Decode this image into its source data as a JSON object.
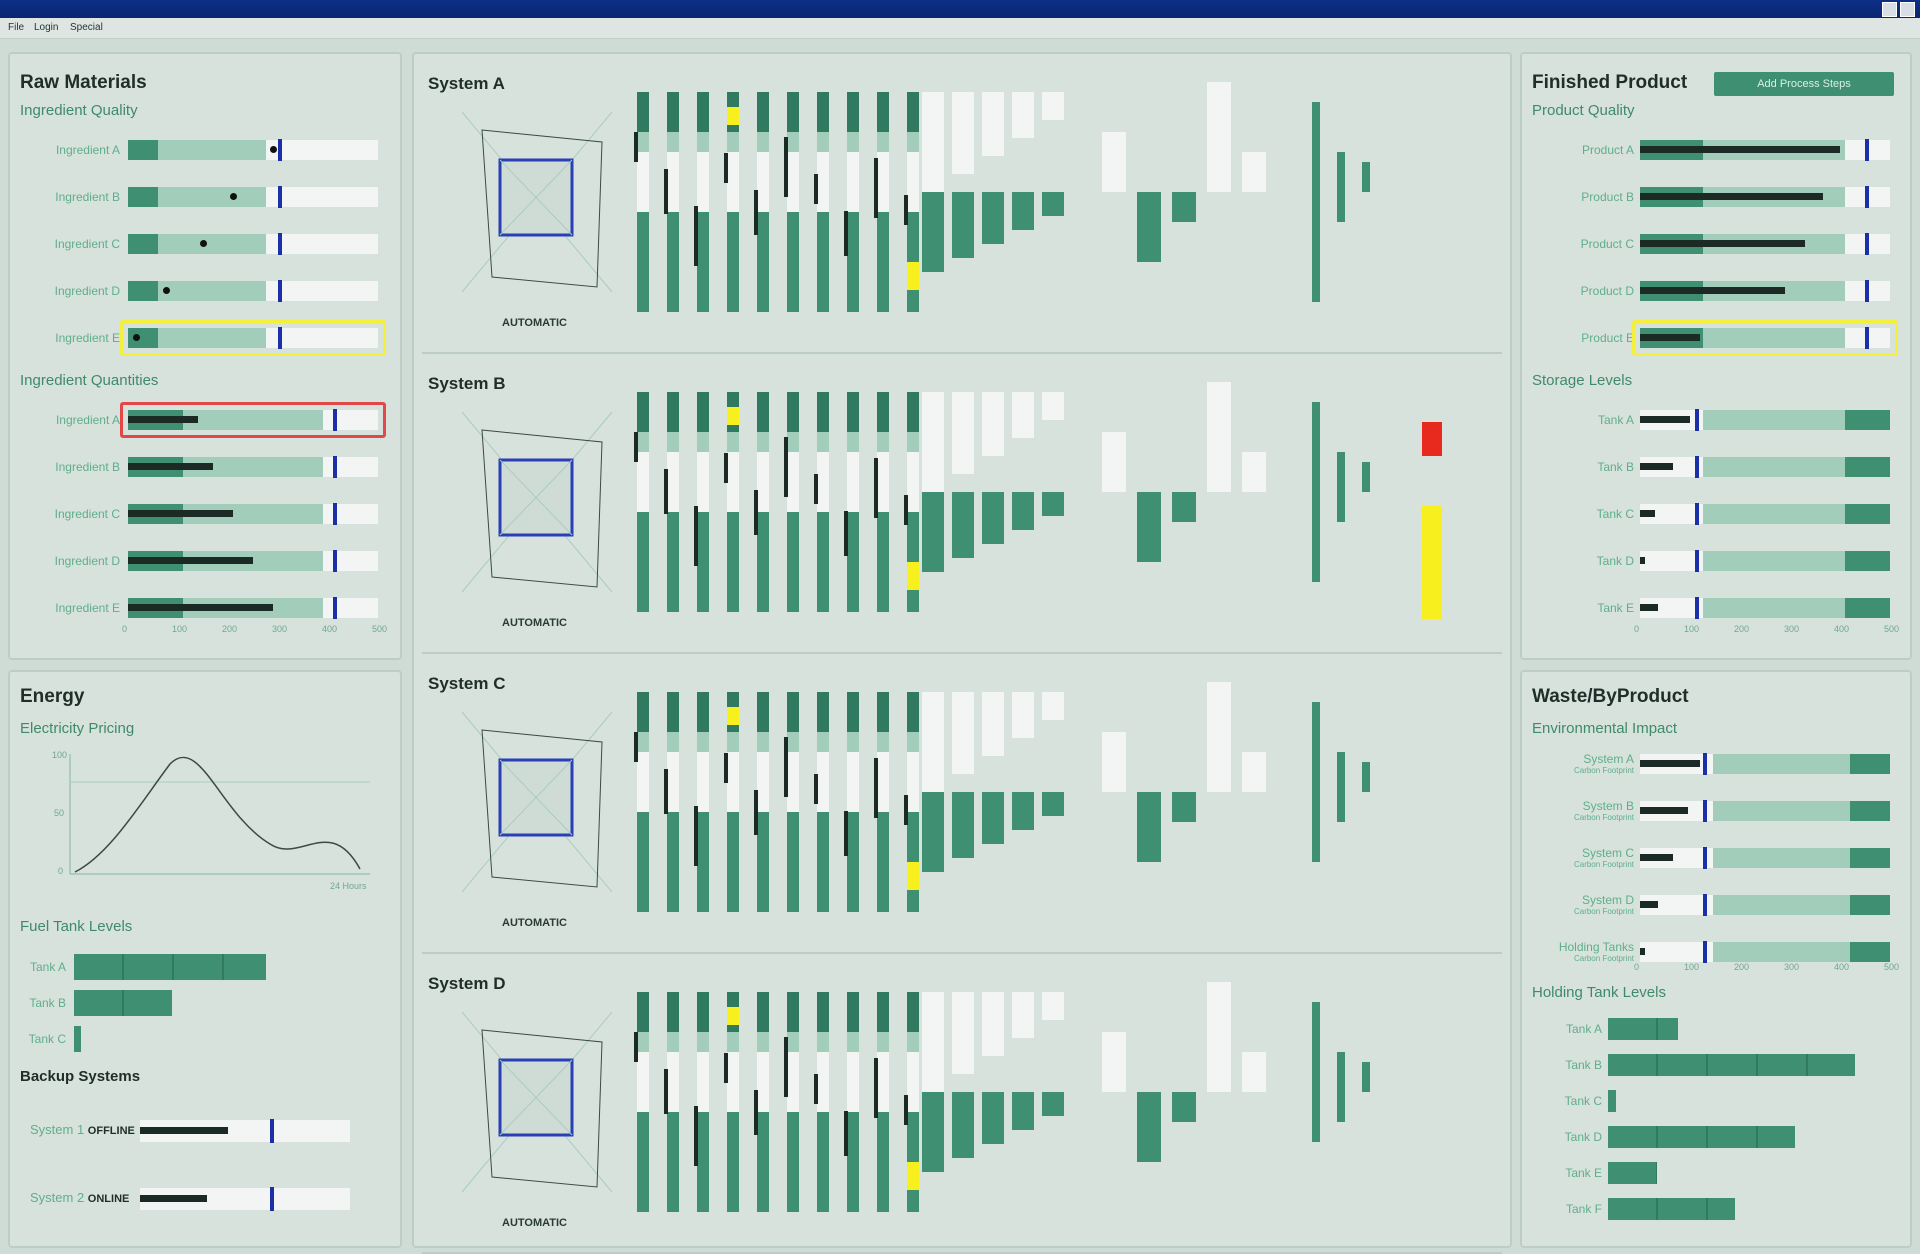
{
  "window": {
    "title": "",
    "menu": [
      "File",
      "Login",
      "Special"
    ],
    "user": ""
  },
  "raw_materials": {
    "title": "Raw Materials",
    "quality_title": "Ingredient Quality",
    "quality_items": [
      {
        "label": "Ingredient A",
        "value": 0.58
      },
      {
        "label": "Ingredient B",
        "value": 0.42
      },
      {
        "label": "Ingredient C",
        "value": 0.3
      },
      {
        "label": "Ingredient D",
        "value": 0.15
      },
      {
        "label": "Ingredient E",
        "value": 0.03
      }
    ],
    "quantities_title": "Ingredient Quantities",
    "quantity_items": [
      {
        "label": "Ingredient A",
        "value": 0.28
      },
      {
        "label": "Ingredient B",
        "value": 0.34
      },
      {
        "label": "Ingredient C",
        "value": 0.42
      },
      {
        "label": "Ingredient D",
        "value": 0.5
      },
      {
        "label": "Ingredient E",
        "value": 0.58
      }
    ],
    "axis": [
      "0",
      "100",
      "200",
      "300",
      "400",
      "500"
    ]
  },
  "energy": {
    "title": "Energy",
    "pricing_title": "Electricity Pricing",
    "pricing_axis": [
      "100",
      "50",
      "0"
    ],
    "pricing_xlabel": "24 Hours",
    "fuel_title": "Fuel Tank Levels",
    "fuel": [
      {
        "label": "Tank A",
        "value": 0.8
      },
      {
        "label": "Tank B",
        "value": 0.41
      },
      {
        "label": "Tank C",
        "value": 0.03
      }
    ],
    "backup_title": "Backup Systems",
    "backup": [
      {
        "label": "System 1",
        "status": "OFFLINE",
        "value": 0.42
      },
      {
        "label": "System 2",
        "status": "ONLINE",
        "value": 0.32
      }
    ]
  },
  "systems": [
    {
      "name": "System A",
      "mode": "AUTOMATIC",
      "level": null
    },
    {
      "name": "System B",
      "mode": "AUTOMATIC",
      "level": {
        "red": 0.4,
        "yellow": 0.6
      }
    },
    {
      "name": "System C",
      "mode": "AUTOMATIC",
      "level": null
    },
    {
      "name": "System D",
      "mode": "AUTOMATIC",
      "level": null
    }
  ],
  "finished": {
    "title": "Finished Product",
    "button": "Add Process Steps",
    "quality_title": "Product Quality",
    "quality_items": [
      {
        "label": "Product A",
        "value": 0.8
      },
      {
        "label": "Product B",
        "value": 0.73
      },
      {
        "label": "Product C",
        "value": 0.66
      },
      {
        "label": "Product D",
        "value": 0.58
      },
      {
        "label": "Product E",
        "value": 0.24
      }
    ],
    "storage_title": "Storage Levels",
    "storage": [
      {
        "label": "Tank A",
        "value": 0.2
      },
      {
        "label": "Tank B",
        "value": 0.13
      },
      {
        "label": "Tank C",
        "value": 0.06
      },
      {
        "label": "Tank D",
        "value": 0.02
      },
      {
        "label": "Tank E",
        "value": 0.07
      }
    ],
    "axis": [
      "0",
      "100",
      "200",
      "300",
      "400",
      "500"
    ]
  },
  "waste": {
    "title": "Waste/ByProduct",
    "impact_title": "Environmental Impact",
    "impact": [
      {
        "label": "System A",
        "sub": "Carbon Footprint",
        "value": 0.24
      },
      {
        "label": "System B",
        "sub": "Carbon Footprint",
        "value": 0.19
      },
      {
        "label": "System C",
        "sub": "Carbon Footprint",
        "value": 0.13
      },
      {
        "label": "System D",
        "sub": "Carbon Footprint",
        "value": 0.07
      },
      {
        "label": "Holding Tanks",
        "sub": "Carbon Footprint",
        "value": 0.02
      }
    ],
    "holding_title": "Holding Tank Levels",
    "holding": [
      {
        "label": "Tank A",
        "value": 0.27
      },
      {
        "label": "Tank B",
        "value": 0.95
      },
      {
        "label": "Tank C",
        "value": 0.03
      },
      {
        "label": "Tank D",
        "value": 0.72
      },
      {
        "label": "Tank E",
        "value": 0.19
      },
      {
        "label": "Tank F",
        "value": 0.49
      }
    ],
    "axis": [
      "0",
      "100",
      "200",
      "300",
      "400",
      "500"
    ]
  },
  "colors": {
    "accent": "#3f9073",
    "light": "#a2cdbb",
    "marker": "#1b2fa8",
    "bg": "#cfdcd6",
    "alert_red": "#e82a1e",
    "alert_yellow": "#f7ef1e"
  }
}
